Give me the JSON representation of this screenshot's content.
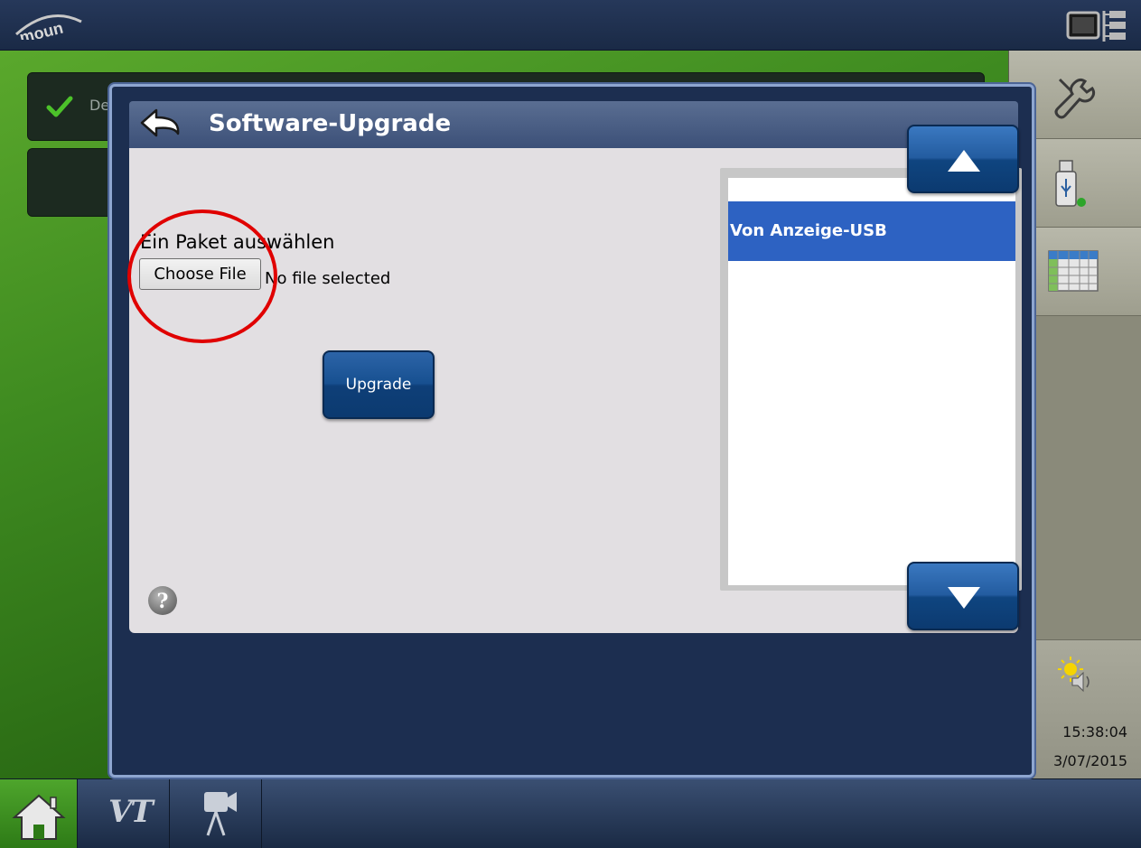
{
  "top_bar": {
    "logo_text": "moun",
    "logo_icon": "brand-logo",
    "layout_icon": "screen-layout-icon"
  },
  "background": {
    "card_text": "De",
    "check_icon": "check-icon"
  },
  "modal": {
    "title": "Software-Upgrade",
    "back_icon": "back-arrow-icon",
    "select_label": "Ein Paket auswählen",
    "choose_file_label": "Choose File",
    "file_status": "No file selected",
    "upgrade_label": "Upgrade",
    "help_icon": "help-icon",
    "list_items": [
      {
        "label": "Von Anzeige-USB",
        "selected": true
      }
    ],
    "scroll_up_icon": "arrow-up-icon",
    "scroll_down_icon": "arrow-down-icon"
  },
  "sidebar": {
    "items": [
      {
        "icon": "wrench-icon"
      },
      {
        "icon": "usb-drive-icon"
      },
      {
        "icon": "table-icon"
      }
    ],
    "status_icon": "brightness-volume-icon",
    "time": "15:38:04",
    "date": "3/07/2015"
  },
  "bottom_bar": {
    "home_icon": "home-icon",
    "vt_label": "VT",
    "camera_icon": "camera-icon"
  },
  "colors": {
    "header_blue": "#3c5078",
    "content_gray": "#e2dfe2",
    "button_blue": "#175090",
    "selection_blue": "#2d62c2",
    "annotation_red": "#e00000",
    "background_green": "#3e8a20"
  }
}
